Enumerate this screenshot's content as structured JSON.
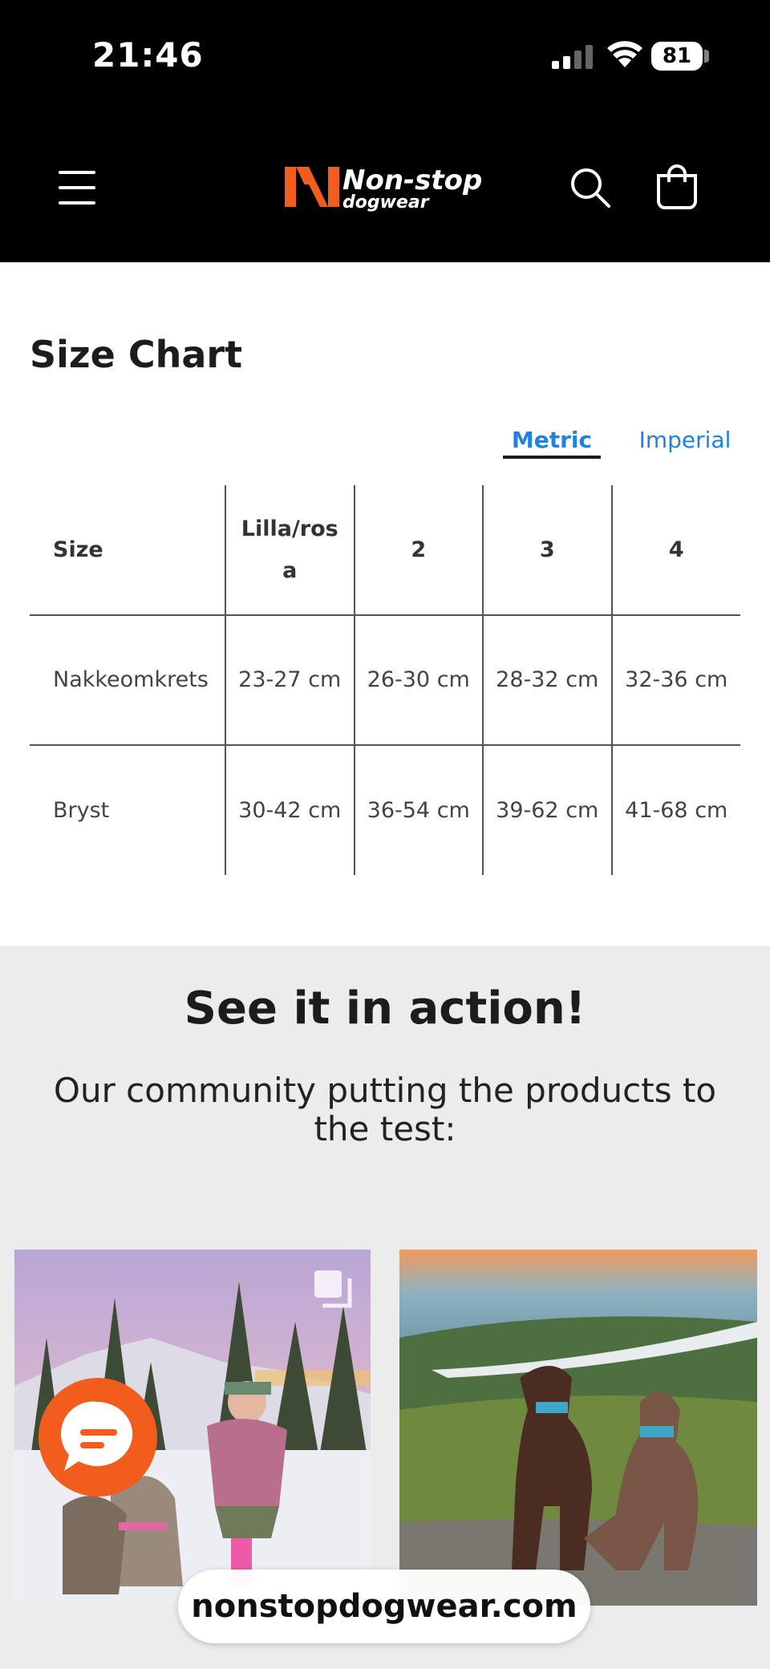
{
  "status_bar": {
    "time": "21:46",
    "battery": "81"
  },
  "header": {
    "brand_line1": "Non-stop",
    "brand_line2": "dogwear"
  },
  "size_chart": {
    "title": "Size Chart",
    "tabs": [
      "Metric",
      "Imperial"
    ],
    "active_tab": "Metric",
    "columns": [
      "Size",
      "Lilla/rosa",
      "2",
      "3",
      "4"
    ],
    "rows": [
      {
        "label": "Nakkeomkrets",
        "values": [
          "23-27 cm",
          "26-30 cm",
          "28-32 cm",
          "32-36 cm"
        ]
      },
      {
        "label": "Bryst",
        "values": [
          "30-42 cm",
          "36-54 cm",
          "39-62 cm",
          "41-68 cm"
        ]
      }
    ]
  },
  "community": {
    "title": "See it in action!",
    "subtitle": "Our community putting the products to the test:"
  },
  "browser": {
    "url": "nonstopdogwear.com"
  },
  "colors": {
    "accent": "#1e82e0",
    "brand_orange": "#f25c1c",
    "header_bg": "#000000",
    "section_bg": "#ececec"
  }
}
